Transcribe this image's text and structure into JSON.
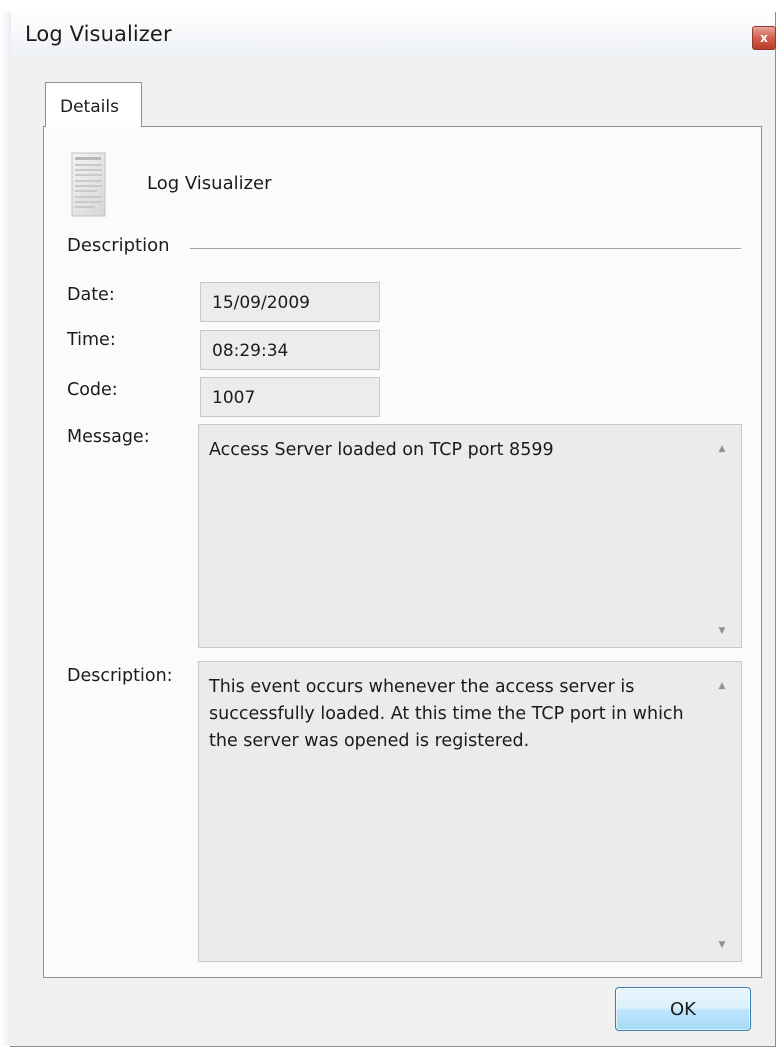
{
  "window": {
    "title": "Log Visualizer",
    "close_glyph": "x"
  },
  "tabs": [
    {
      "label": "Details",
      "active": true
    }
  ],
  "header": {
    "icon": "document-icon",
    "app_name": "Log Visualizer"
  },
  "section": {
    "label": "Description"
  },
  "fields": {
    "date": {
      "label": "Date:",
      "value": "15/09/2009"
    },
    "time": {
      "label": "Time:",
      "value": "08:29:34"
    },
    "code": {
      "label": "Code:",
      "value": "1007"
    },
    "message": {
      "label": "Message:",
      "value": "Access Server loaded on TCP port 8599"
    },
    "description": {
      "label": "Description:",
      "value": "This event occurs whenever the access server is successfully loaded. At this time the TCP port in which the server was opened is registered."
    }
  },
  "scroll_icons": {
    "up": "scroll-up-arrow-icon",
    "down": "scroll-down-arrow-icon"
  },
  "buttons": {
    "ok_label": "OK"
  },
  "colors": {
    "window_bg": "#f0f0f0",
    "panel_bg": "#fbfbfb",
    "readonly_field_bg": "#ececec",
    "close_button": "#c94c39",
    "ok_button": "#bee6fd"
  }
}
